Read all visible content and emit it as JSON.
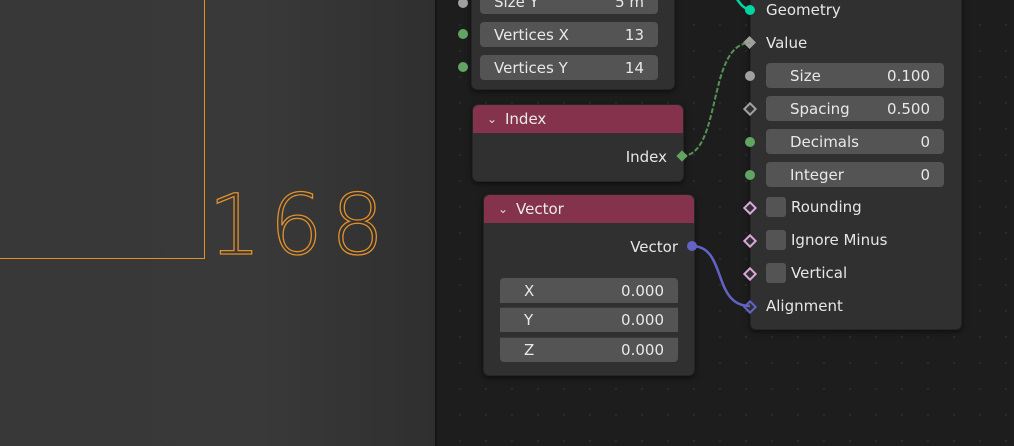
{
  "viewport": {
    "display_number": "168"
  },
  "grid_node": {
    "fields": [
      {
        "label": "Size Y",
        "value": "5 m"
      },
      {
        "label": "Vertices X",
        "value": "13"
      },
      {
        "label": "Vertices Y",
        "value": "14"
      }
    ]
  },
  "index_node": {
    "title": "Index",
    "output": "Index"
  },
  "vector_node": {
    "title": "Vector",
    "output": "Vector",
    "fields": [
      {
        "label": "X",
        "value": "0.000"
      },
      {
        "label": "Y",
        "value": "0.000"
      },
      {
        "label": "Z",
        "value": "0.000"
      }
    ]
  },
  "text_node": {
    "geometry_label": "Geometry",
    "value_label": "Value",
    "fields": [
      {
        "label": "Size",
        "value": "0.100"
      },
      {
        "label": "Spacing",
        "value": "0.500"
      },
      {
        "label": "Decimals",
        "value": "0"
      },
      {
        "label": "Integer",
        "value": "0"
      }
    ],
    "checkboxes": [
      {
        "label": "Rounding"
      },
      {
        "label": "Ignore Minus"
      },
      {
        "label": "Vertical"
      }
    ],
    "alignment_label": "Alignment"
  },
  "colors": {
    "node_header": "#85334d",
    "link_float": "#62a562",
    "link_vector": "#6363c7",
    "viewport_accent": "#e0902c"
  }
}
